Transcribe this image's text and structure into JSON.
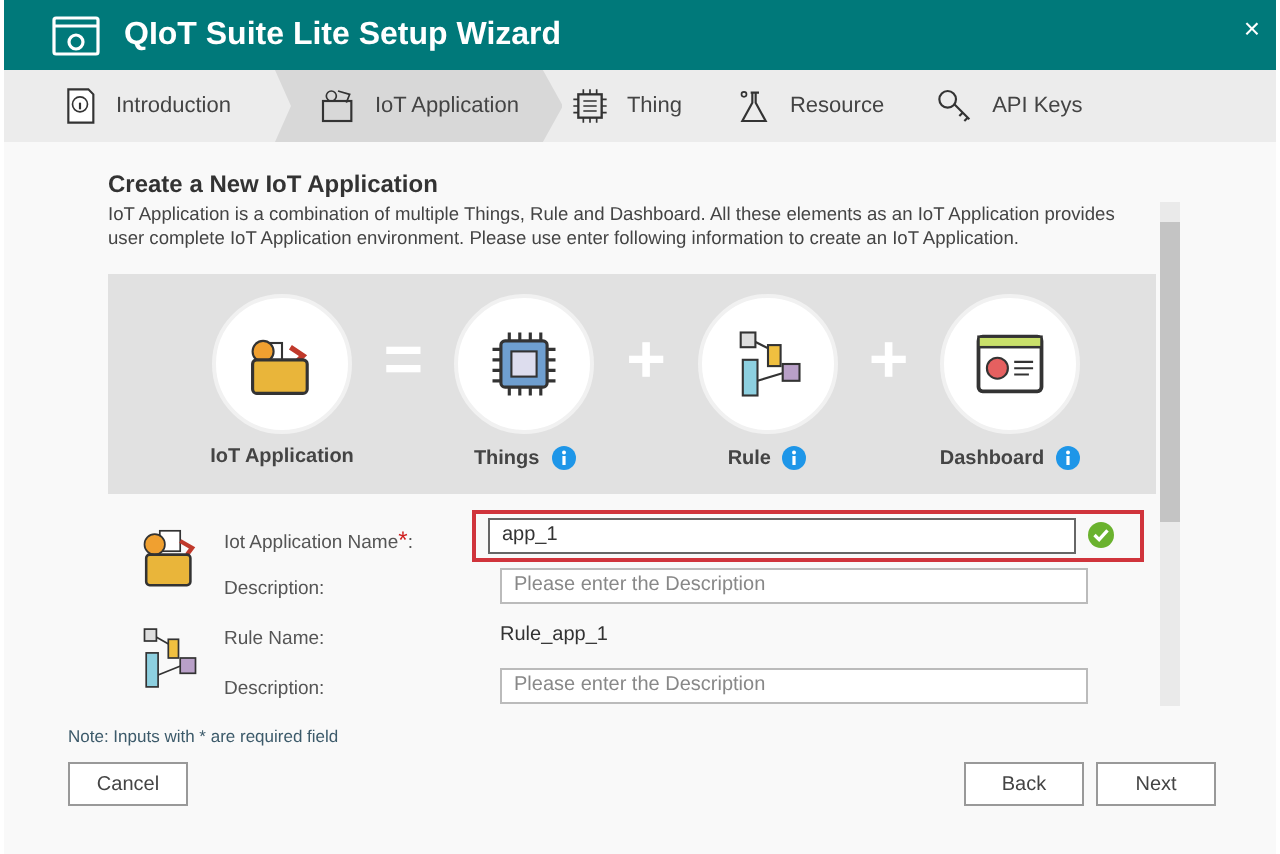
{
  "window": {
    "title": "QIoT Suite Lite Setup Wizard",
    "close": "×"
  },
  "steps": [
    {
      "label": "Introduction",
      "kind": "info",
      "selected": false
    },
    {
      "label": "IoT Application",
      "kind": "app",
      "selected": true
    },
    {
      "label": "Thing",
      "kind": "chip",
      "selected": false
    },
    {
      "label": "Resource",
      "kind": "flask",
      "selected": false
    },
    {
      "label": "API Keys",
      "kind": "key",
      "selected": false
    }
  ],
  "heading": "Create a New IoT Application",
  "description": "IoT Application is a combination of multiple Things, Rule and Dashboard. All these elements as an IoT Application provides user complete IoT Application environment. Please use enter following information to create an IoT Application.",
  "diagram": [
    {
      "label": "IoT Application",
      "kind": "app",
      "info": false
    },
    {
      "operator": "="
    },
    {
      "label": "Things",
      "kind": "chip",
      "info": true
    },
    {
      "operator": "+"
    },
    {
      "label": "Rule",
      "kind": "rule",
      "info": true
    },
    {
      "operator": "+"
    },
    {
      "label": "Dashboard",
      "kind": "dash",
      "info": true
    }
  ],
  "form": [
    {
      "kind": "app",
      "fields": [
        {
          "kind": "input",
          "label": "Iot Application Name",
          "required_mark": "*",
          "suffix": ":",
          "value": "app_1",
          "valid": true,
          "highlighted": true
        },
        {
          "kind": "input",
          "label": "Description:",
          "placeholder": "Please enter the Description"
        }
      ]
    },
    {
      "kind": "rule",
      "fields": [
        {
          "kind": "text",
          "label": "Rule Name:",
          "value": "Rule_app_1"
        },
        {
          "kind": "input",
          "label": "Description:",
          "placeholder": "Please enter the Description"
        }
      ]
    }
  ],
  "note": "Note: Inputs with * are required field",
  "buttons": {
    "left": [
      "Cancel"
    ],
    "right": [
      "Back",
      "Next"
    ]
  }
}
